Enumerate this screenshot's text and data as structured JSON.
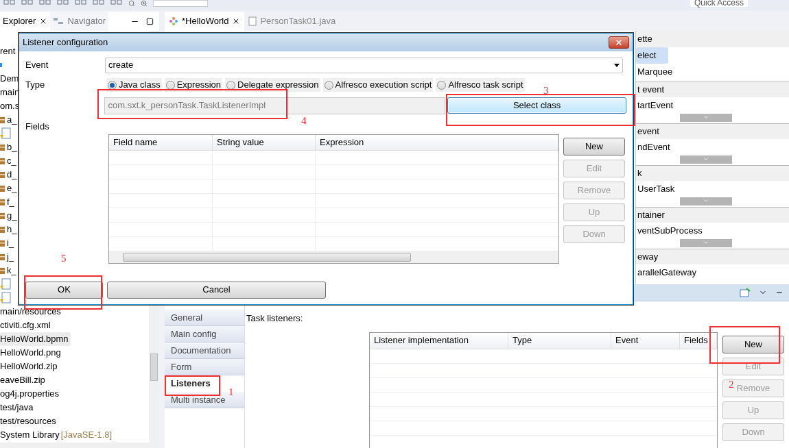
{
  "toolbar": {
    "quick_access": "Quick Access"
  },
  "view_tabs": [
    {
      "label": "Explorer",
      "selected": true,
      "closable": true
    },
    {
      "label": "Navigator",
      "selected": false,
      "closable": false
    }
  ],
  "editor_tabs": [
    {
      "label": "*HelloWorld",
      "selected": true,
      "closable": true
    },
    {
      "label": "PersonTask01.java",
      "selected": false,
      "closable": false
    }
  ],
  "explorer": {
    "items": [
      {
        "label": "rent",
        "kind": "text",
        "selected": false
      },
      {
        "kind": "marker",
        "selected": false
      },
      {
        "label": "Dem",
        "kind": "text",
        "selected": false
      },
      {
        "label": "main",
        "kind": "text",
        "selected": false
      },
      {
        "label": "om.s",
        "kind": "text",
        "selected": false
      },
      {
        "label": "a_",
        "kind": "package",
        "selected": false
      },
      {
        "kind": "java",
        "selected": false
      },
      {
        "label": "b_",
        "kind": "package",
        "selected": false
      },
      {
        "label": "c_",
        "kind": "package",
        "selected": false
      },
      {
        "label": "d_",
        "kind": "package",
        "selected": false
      },
      {
        "label": "e_",
        "kind": "package",
        "selected": false
      },
      {
        "label": "f_",
        "kind": "package",
        "selected": false
      },
      {
        "label": "g_",
        "kind": "package",
        "selected": false
      },
      {
        "label": "h_",
        "kind": "package",
        "selected": false
      },
      {
        "label": "i_",
        "kind": "package",
        "selected": false
      },
      {
        "label": "j_",
        "kind": "package",
        "selected": false
      },
      {
        "label": "k_",
        "kind": "package",
        "selected": false
      },
      {
        "kind": "java",
        "selected": false
      },
      {
        "kind": "java",
        "selected": false
      },
      {
        "label": "main/resources",
        "kind": "text",
        "selected": false
      },
      {
        "label": "ctiviti.cfg.xml",
        "kind": "text",
        "selected": false
      },
      {
        "label": "HelloWorld.bpmn",
        "kind": "text",
        "selected": true
      },
      {
        "label": "HelloWorld.png",
        "kind": "text",
        "selected": false
      },
      {
        "label": "HelloWorld.zip",
        "kind": "text",
        "selected": false
      },
      {
        "label": "eaveBill.zip",
        "kind": "text",
        "selected": false
      },
      {
        "label": "og4j.properties",
        "kind": "text",
        "selected": false
      },
      {
        "label": "test/java",
        "kind": "text",
        "selected": false
      },
      {
        "label": "test/resources",
        "kind": "text",
        "selected": false
      },
      {
        "label": "System Library",
        "suffix": "[JavaSE-1.8]",
        "kind": "text",
        "selected": false
      }
    ]
  },
  "palette": {
    "title": "ette",
    "tools": [
      {
        "label": "elect",
        "selected": true
      },
      {
        "label": "Marquee",
        "selected": false
      }
    ],
    "drawers": [
      {
        "title": "t event",
        "items": [
          "tartEvent"
        ],
        "more": true
      },
      {
        "title": "event",
        "items": [
          "ndEvent"
        ],
        "more": true
      },
      {
        "title": "k",
        "items": [
          "UserTask"
        ],
        "more": true
      },
      {
        "title": "ntainer",
        "items": [
          "ventSubProcess"
        ],
        "more": true
      },
      {
        "title": "eway",
        "items": [
          "arallelGateway"
        ],
        "more": false
      }
    ]
  },
  "properties": {
    "tabs": [
      {
        "label": "General",
        "selected": false
      },
      {
        "label": "Main config",
        "selected": false
      },
      {
        "label": "Documentation",
        "selected": false
      },
      {
        "label": "Form",
        "selected": false
      },
      {
        "label": "Listeners",
        "selected": true
      },
      {
        "label": "Multi instance",
        "selected": false
      }
    ],
    "section_label": "Task listeners:",
    "table": {
      "columns": [
        "Listener implementation",
        "Type",
        "Event",
        "Fields"
      ]
    },
    "buttons": [
      {
        "label": "New",
        "disabled": false
      },
      {
        "label": "Edit",
        "disabled": true
      },
      {
        "label": "Remove",
        "disabled": true
      },
      {
        "label": "Up",
        "disabled": true
      },
      {
        "label": "Down",
        "disabled": true
      }
    ]
  },
  "dialog": {
    "title": "Listener configuration",
    "event": {
      "label": "Event",
      "value": "create"
    },
    "type": {
      "label": "Type",
      "options": [
        {
          "label": "Java class",
          "selected": true
        },
        {
          "label": "Expression",
          "selected": false
        },
        {
          "label": "Delegate expression",
          "selected": false
        },
        {
          "label": "Alfresco execution script",
          "selected": false
        },
        {
          "label": "Alfresco task script",
          "selected": false
        }
      ]
    },
    "class_field": {
      "value": "com.sxt.k_personTask.TaskListenerImpl",
      "disabled": true
    },
    "select_button": "Select class",
    "fields": {
      "label": "Fields",
      "columns": [
        "Field name",
        "String value",
        "Expression"
      ]
    },
    "buttons": [
      {
        "label": "New",
        "disabled": false
      },
      {
        "label": "Edit",
        "disabled": true
      },
      {
        "label": "Remove",
        "disabled": true
      },
      {
        "label": "Up",
        "disabled": true
      },
      {
        "label": "Down",
        "disabled": true
      }
    ],
    "ok": "OK",
    "cancel": "Cancel"
  },
  "annotations": [
    {
      "label": "1"
    },
    {
      "label": "2"
    },
    {
      "label": "3"
    },
    {
      "label": "4"
    },
    {
      "label": "5"
    }
  ]
}
